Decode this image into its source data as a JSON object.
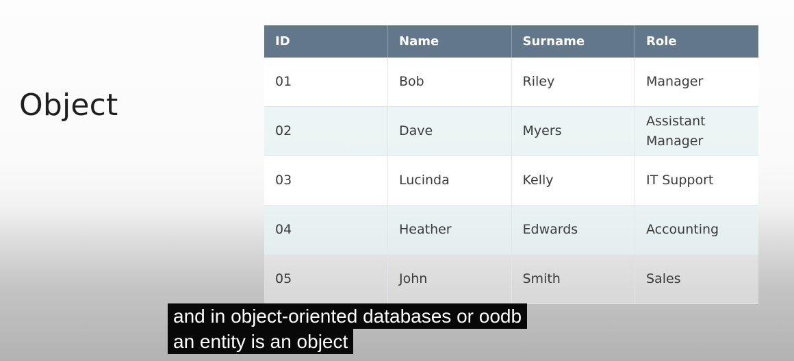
{
  "slide": {
    "title": "Object"
  },
  "table": {
    "headers": [
      "ID",
      "Name",
      "Surname",
      "Role"
    ],
    "rows": [
      [
        "01",
        "Bob",
        "Riley",
        "Manager"
      ],
      [
        "02",
        "Dave",
        "Myers",
        "Assistant Manager"
      ],
      [
        "03",
        "Lucinda",
        "Kelly",
        "IT Support"
      ],
      [
        "04",
        "Heather",
        "Edwards",
        "Accounting"
      ],
      [
        "05",
        "John",
        "Smith",
        "Sales"
      ]
    ]
  },
  "captions": {
    "line1": "and in object-oriented databases or oodb",
    "line2": "an entity is an object"
  },
  "colors": {
    "header_bg": "#63778a",
    "header_text": "#ffffff",
    "alt_row_bg": "#e8f3f3",
    "caption_bg": "#080808"
  }
}
